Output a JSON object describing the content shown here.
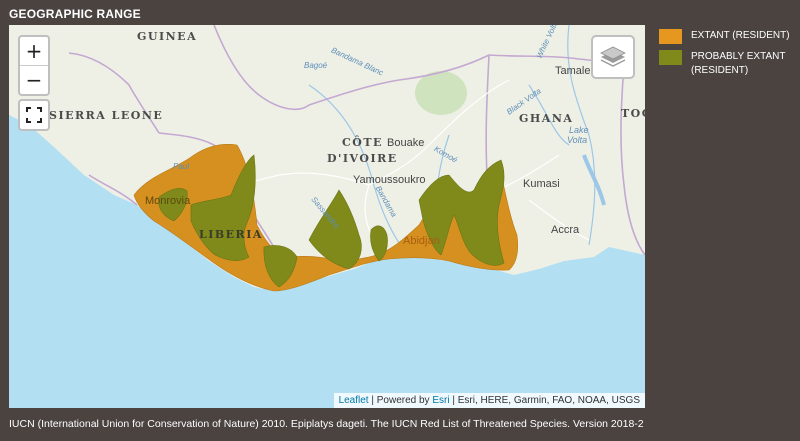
{
  "panel": {
    "title": "GEOGRAPHIC RANGE"
  },
  "map": {
    "zoom_in": "+",
    "zoom_out": "−",
    "labels": {
      "guinea": "GUINEA",
      "sierra_leone": "SIERRA LEONE",
      "cote_divoire_1": "CÔTE",
      "cote_divoire_2": "D'IVOIRE",
      "ghana": "GHANA",
      "togo": "TOG",
      "liberia": "LIBERIA",
      "monrovia": "Monrovia",
      "bouake": "Bouake",
      "yamoussoukro": "Yamoussoukro",
      "kumasi": "Kumasi",
      "accra": "Accra",
      "abidjan": "Abidjan",
      "tamale": "Tamale",
      "paul": "Paul",
      "bagoe": "Bagoé",
      "bandama_blanc": "Bandama Blanc",
      "komoe": "Komoé",
      "sassandra": "Sassandra",
      "bandama": "Bandama",
      "black_volta": "Black Volta",
      "white_volta": "White Volta",
      "lake_volta_1": "Lake",
      "lake_volta_2": "Volta"
    },
    "attribution": {
      "leaflet": "Leaflet",
      "separator": " | ",
      "powered_by": "Powered by ",
      "esri": "Esri",
      "sources": " | Esri, HERE, Garmin, FAO, NOAA, USGS"
    },
    "colors": {
      "extant": "#d6901f",
      "probably_extant": "#7f8a1a",
      "ocean": "#b3dff2",
      "land": "#eef0e6"
    }
  },
  "legend": {
    "items": [
      {
        "label": "EXTANT (RESIDENT)",
        "color": "#e6971f"
      },
      {
        "label": "PROBABLY EXTANT (RESIDENT)",
        "color": "#7f8a1a"
      }
    ]
  },
  "citation": "IUCN (International Union for Conservation of Nature) 2010. Epiplatys dageti. The IUCN Red List of Threatened Species. Version 2018-2"
}
